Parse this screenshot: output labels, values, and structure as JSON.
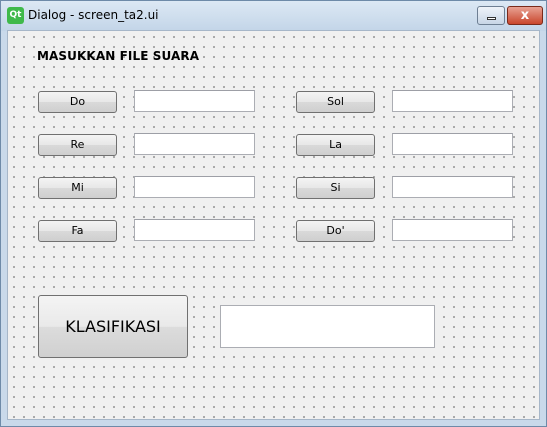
{
  "window": {
    "title": "Dialog - screen_ta2.ui",
    "logo_text": "Qt",
    "minimize_glyph": "",
    "close_glyph": "x"
  },
  "form": {
    "heading": "MASUKKAN FILE SUARA",
    "notes": [
      {
        "label": "Do",
        "value": ""
      },
      {
        "label": "Re",
        "value": ""
      },
      {
        "label": "Mi",
        "value": ""
      },
      {
        "label": "Fa",
        "value": ""
      },
      {
        "label": "Sol",
        "value": ""
      },
      {
        "label": "La",
        "value": ""
      },
      {
        "label": "Si",
        "value": ""
      },
      {
        "label": "Do'",
        "value": ""
      }
    ],
    "classify_label": "KLASIFIKASI",
    "result_value": ""
  }
}
